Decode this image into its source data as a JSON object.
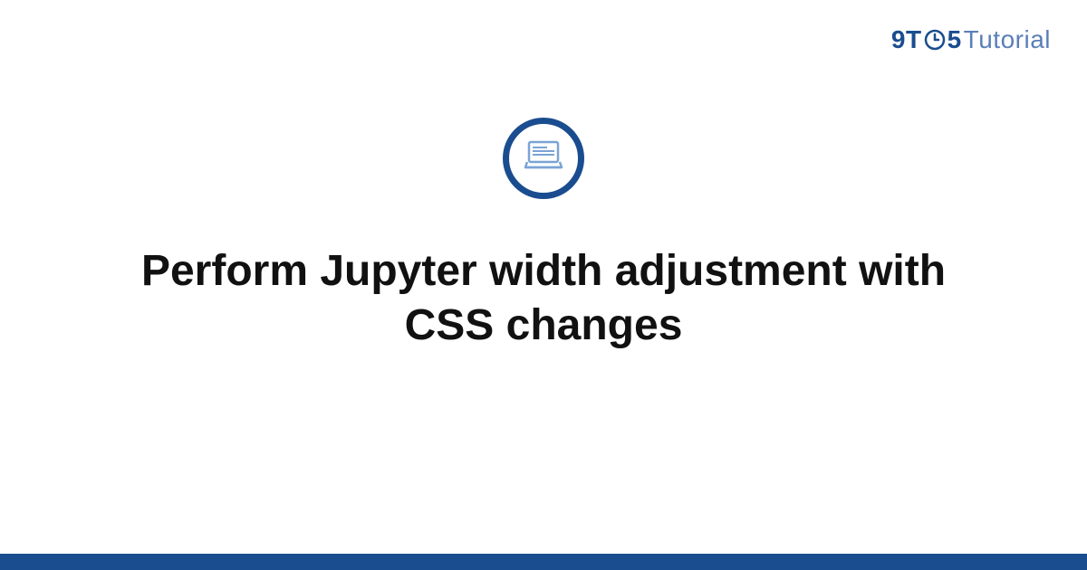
{
  "logo": {
    "part1": "9T",
    "part2": "5",
    "part3": "Tutorial"
  },
  "icon": {
    "name": "laptop-icon"
  },
  "title": "Perform Jupyter width adjustment with CSS changes",
  "colors": {
    "primary": "#1a4d8f",
    "secondary": "#5a7fb8"
  }
}
